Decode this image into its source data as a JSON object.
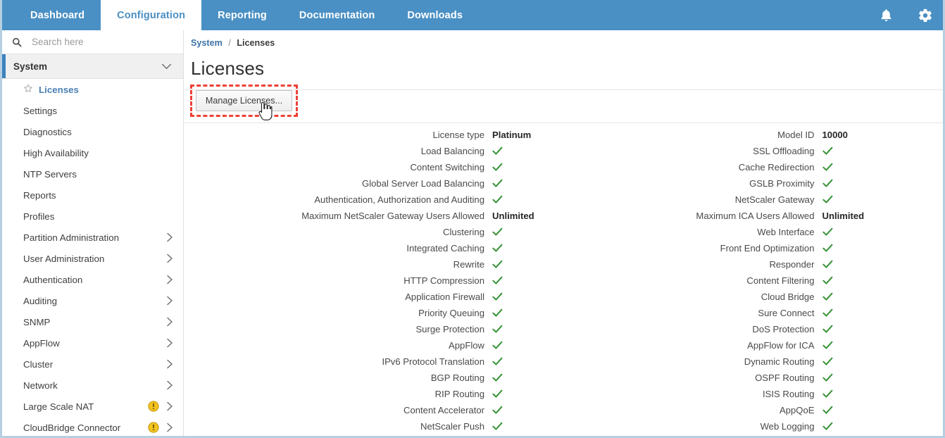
{
  "topnav": {
    "tabs": [
      {
        "label": "Dashboard",
        "active": false
      },
      {
        "label": "Configuration",
        "active": true
      },
      {
        "label": "Reporting",
        "active": false
      },
      {
        "label": "Documentation",
        "active": false
      },
      {
        "label": "Downloads",
        "active": false
      }
    ],
    "icons": [
      {
        "name": "bell-icon"
      },
      {
        "name": "gear-icon"
      }
    ],
    "bg_color": "#4a90c4",
    "active_tab_text_color": "#4a8fc3"
  },
  "sidebar": {
    "search": {
      "placeholder": "Search here",
      "value": "",
      "icon": "search-icon"
    },
    "group": {
      "label": "System",
      "expanded": true,
      "chevron": "chevron-down-icon",
      "accent_color": "#3d82bd"
    },
    "items": [
      {
        "label": "Licenses",
        "selected": true,
        "star": true,
        "warning": false,
        "chevron": false
      },
      {
        "label": "Settings",
        "selected": false,
        "star": false,
        "warning": false,
        "chevron": false
      },
      {
        "label": "Diagnostics",
        "selected": false,
        "star": false,
        "warning": false,
        "chevron": false
      },
      {
        "label": "High Availability",
        "selected": false,
        "star": false,
        "warning": false,
        "chevron": false
      },
      {
        "label": "NTP Servers",
        "selected": false,
        "star": false,
        "warning": false,
        "chevron": false
      },
      {
        "label": "Reports",
        "selected": false,
        "star": false,
        "warning": false,
        "chevron": false
      },
      {
        "label": "Profiles",
        "selected": false,
        "star": false,
        "warning": false,
        "chevron": false
      },
      {
        "label": "Partition Administration",
        "selected": false,
        "star": false,
        "warning": false,
        "chevron": true
      },
      {
        "label": "User Administration",
        "selected": false,
        "star": false,
        "warning": false,
        "chevron": true
      },
      {
        "label": "Authentication",
        "selected": false,
        "star": false,
        "warning": false,
        "chevron": true
      },
      {
        "label": "Auditing",
        "selected": false,
        "star": false,
        "warning": false,
        "chevron": true
      },
      {
        "label": "SNMP",
        "selected": false,
        "star": false,
        "warning": false,
        "chevron": true
      },
      {
        "label": "AppFlow",
        "selected": false,
        "star": false,
        "warning": false,
        "chevron": true
      },
      {
        "label": "Cluster",
        "selected": false,
        "star": false,
        "warning": false,
        "chevron": true
      },
      {
        "label": "Network",
        "selected": false,
        "star": false,
        "warning": false,
        "chevron": true
      },
      {
        "label": "Large Scale NAT",
        "selected": false,
        "star": false,
        "warning": true,
        "chevron": true
      },
      {
        "label": "CloudBridge Connector",
        "selected": false,
        "star": false,
        "warning": true,
        "chevron": true
      }
    ],
    "warning_color": "#f0c01e"
  },
  "main": {
    "breadcrumb": {
      "parent": "System",
      "separator": "/",
      "current": "Licenses"
    },
    "title": "Licenses",
    "toolbar": {
      "manage_licenses_label": "Manage Licenses...",
      "highlight_color": "#ef4136",
      "cursor": "pointer-hand-cursor"
    },
    "license_table": {
      "check_color": "#349134",
      "left_column": [
        {
          "label": "License type",
          "value": "Platinum",
          "check": false
        },
        {
          "label": "Load Balancing",
          "value": "",
          "check": true
        },
        {
          "label": "Content Switching",
          "value": "",
          "check": true
        },
        {
          "label": "Global Server Load Balancing",
          "value": "",
          "check": true
        },
        {
          "label": "Authentication, Authorization and Auditing",
          "value": "",
          "check": true
        },
        {
          "label": "Maximum NetScaler Gateway Users Allowed",
          "value": "Unlimited",
          "check": false
        },
        {
          "label": "Clustering",
          "value": "",
          "check": true
        },
        {
          "label": "Integrated Caching",
          "value": "",
          "check": true
        },
        {
          "label": "Rewrite",
          "value": "",
          "check": true
        },
        {
          "label": "HTTP Compression",
          "value": "",
          "check": true
        },
        {
          "label": "Application Firewall",
          "value": "",
          "check": true
        },
        {
          "label": "Priority Queuing",
          "value": "",
          "check": true
        },
        {
          "label": "Surge Protection",
          "value": "",
          "check": true
        },
        {
          "label": "AppFlow",
          "value": "",
          "check": true
        },
        {
          "label": "IPv6 Protocol Translation",
          "value": "",
          "check": true
        },
        {
          "label": "BGP Routing",
          "value": "",
          "check": true
        },
        {
          "label": "RIP Routing",
          "value": "",
          "check": true
        },
        {
          "label": "Content Accelerator",
          "value": "",
          "check": true
        },
        {
          "label": "NetScaler Push",
          "value": "",
          "check": true
        }
      ],
      "right_column": [
        {
          "label": "Model ID",
          "value": "10000",
          "check": false
        },
        {
          "label": "SSL Offloading",
          "value": "",
          "check": true
        },
        {
          "label": "Cache Redirection",
          "value": "",
          "check": true
        },
        {
          "label": "GSLB Proximity",
          "value": "",
          "check": true
        },
        {
          "label": "NetScaler Gateway",
          "value": "",
          "check": true
        },
        {
          "label": "Maximum ICA Users Allowed",
          "value": "Unlimited",
          "check": false
        },
        {
          "label": "Web Interface",
          "value": "",
          "check": true
        },
        {
          "label": "Front End Optimization",
          "value": "",
          "check": true
        },
        {
          "label": "Responder",
          "value": "",
          "check": true
        },
        {
          "label": "Content Filtering",
          "value": "",
          "check": true
        },
        {
          "label": "Cloud Bridge",
          "value": "",
          "check": true
        },
        {
          "label": "Sure Connect",
          "value": "",
          "check": true
        },
        {
          "label": "DoS Protection",
          "value": "",
          "check": true
        },
        {
          "label": "AppFlow for ICA",
          "value": "",
          "check": true
        },
        {
          "label": "Dynamic Routing",
          "value": "",
          "check": true
        },
        {
          "label": "OSPF Routing",
          "value": "",
          "check": true
        },
        {
          "label": "ISIS Routing",
          "value": "",
          "check": true
        },
        {
          "label": "AppQoE",
          "value": "",
          "check": true
        },
        {
          "label": "Web Logging",
          "value": "",
          "check": true
        }
      ]
    }
  }
}
